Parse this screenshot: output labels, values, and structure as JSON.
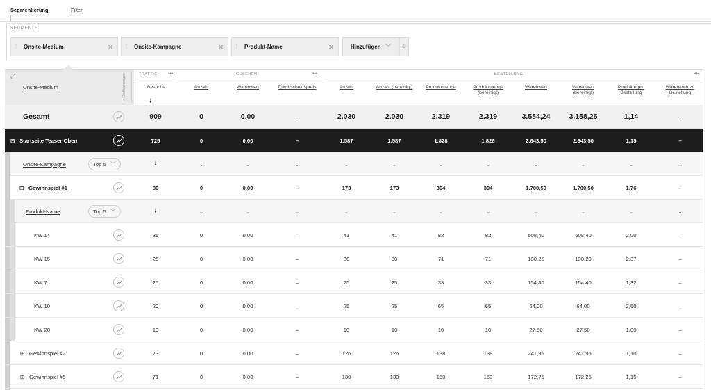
{
  "nav": {
    "segmentation_label": "Segmentierung",
    "filter_label": "Filter"
  },
  "segments": {
    "title": "SEGMENTE",
    "chips": [
      {
        "label": "Onsite-Medium"
      },
      {
        "label": "Onsite-Kampagne"
      },
      {
        "label": "Produkt-Name"
      }
    ],
    "add_label": "Hinzufügen"
  },
  "table": {
    "dimension_header": "Onsite-Medium",
    "vertical_header": "In Grafik anzeigen",
    "groups": {
      "traffic": "TRAFFIC",
      "gesehen": "GESEHEN",
      "bestellung": "BESTELLUNG"
    },
    "columns": [
      "Besuche",
      "Anzahl",
      "Warenwert",
      "Durchschnittspreis",
      "Anzahl",
      "Anzahl (bereinigt)",
      "Produktmenge",
      "Produktmenge (bereinigt)",
      "Warenwert",
      "Warenwert (bereinigt)",
      "Produkte pro Bestellung",
      "Warenkorb zu Bestellung"
    ],
    "total": {
      "label": "Gesamt",
      "values": [
        "909",
        "0",
        "0,00",
        "–",
        "2.030",
        "2.030",
        "2.319",
        "2.319",
        "3.584,24",
        "3.158,25",
        "1,14",
        "–"
      ]
    },
    "group_row": {
      "label": "Startseite Teaser Oben",
      "values": [
        "725",
        "0",
        "0,00",
        "–",
        "1.587",
        "1.587",
        "1.828",
        "1.828",
        "2.643,50",
        "2.643,50",
        "1,15",
        "–"
      ]
    },
    "picker1": {
      "label": "Onsite-Kampagne",
      "top": "Top 5"
    },
    "sub_row": {
      "label": "Gewinnspiel #1",
      "values": [
        "80",
        "0",
        "0,00",
        "–",
        "173",
        "173",
        "304",
        "304",
        "1.700,50",
        "1.700,50",
        "1,76",
        "–"
      ]
    },
    "picker2": {
      "label": "Produkt-Name",
      "top": "Top 5"
    },
    "leaf_rows": [
      {
        "label": "KW 14",
        "values": [
          "36",
          "0",
          "0,00",
          "–",
          "41",
          "41",
          "82",
          "82",
          "608,40",
          "608,40",
          "2,00",
          "–"
        ]
      },
      {
        "label": "KW 15",
        "values": [
          "25",
          "0",
          "0,00",
          "–",
          "30",
          "30",
          "71",
          "71",
          "130,25",
          "130,20",
          "2,37",
          "–"
        ]
      },
      {
        "label": "KW 7",
        "values": [
          "25",
          "0",
          "0,00",
          "–",
          "25",
          "25",
          "33",
          "33",
          "154,40",
          "154,40",
          "1,32",
          "–"
        ]
      },
      {
        "label": "KW 10",
        "values": [
          "20",
          "0",
          "0,00",
          "–",
          "25",
          "25",
          "65",
          "65",
          "64,00",
          "64,00",
          "2,60",
          "–"
        ]
      },
      {
        "label": "KW 20",
        "values": [
          "10",
          "0",
          "0,00",
          "–",
          "10",
          "10",
          "10",
          "10",
          "27,50",
          "27,50",
          "1,00",
          "–"
        ]
      }
    ],
    "collapsed_rows": [
      {
        "label": "Gewinnspiel #2",
        "values": [
          "73",
          "0",
          "0,00",
          "–",
          "126",
          "126",
          "138",
          "138",
          "241,95",
          "241,95",
          "1,10",
          "–"
        ]
      },
      {
        "label": "Gewinnspiel #5",
        "values": [
          "71",
          "0",
          "0,00",
          "–",
          "130",
          "130",
          "150",
          "150",
          "172,75",
          "172,25",
          "1,15",
          "–"
        ]
      }
    ]
  }
}
